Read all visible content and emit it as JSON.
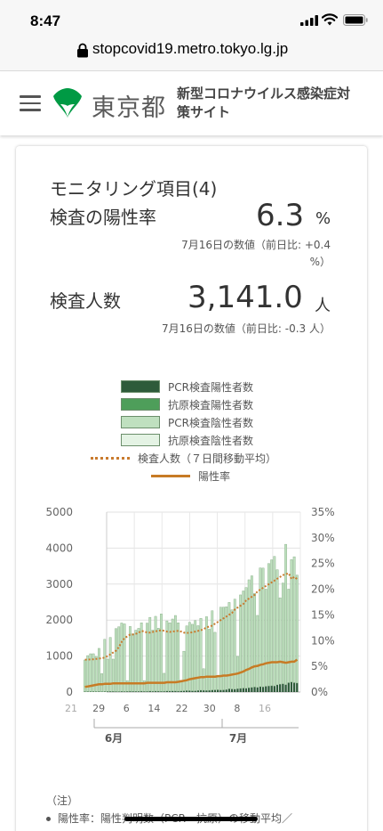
{
  "statusbar": {
    "time": "8:47"
  },
  "browser": {
    "url": "stopcovid19.metro.tokyo.lg.jp"
  },
  "header": {
    "logo_text": "東京都",
    "site_title": "新型コロナウイルス感染症対策サイト"
  },
  "card": {
    "title": "モニタリング項目(4)",
    "positive_rate": {
      "label": "検査の陽性率",
      "value": "6.3",
      "unit": "%",
      "sub": "7月16日の数値（前日比: +0.4 %）"
    },
    "test_count": {
      "label": "検査人数",
      "value": "3,141.0",
      "unit": "人",
      "sub": "7月16日の数値（前日比: -0.3 人）"
    },
    "legend": [
      {
        "label": "PCR検査陽性者数",
        "color": "#2e5b3a"
      },
      {
        "label": "抗原検査陽性者数",
        "color": "#4e9e5a"
      },
      {
        "label": "PCR検査陰性者数",
        "color": "#bfe0bf"
      },
      {
        "label": "抗原検査陰性者数",
        "color": "#e4f3e4"
      },
      {
        "label": "検査人数（７日間移動平均）",
        "color": "#c97b2e",
        "style": "dotted"
      },
      {
        "label": "陽性率",
        "color": "#c77b25",
        "style": "solid"
      }
    ],
    "notes": {
      "heading": "（注）",
      "first": "陽性率：陽性判明数（PCR・抗原）の移動平均／"
    }
  },
  "chart_data": {
    "type": "bar",
    "title": "",
    "x_tick_labels": [
      "21",
      "29",
      "6",
      "14",
      "22",
      "30",
      "8",
      "16"
    ],
    "month_labels": [
      "6月",
      "7月"
    ],
    "y_left": {
      "ticks": [
        "0",
        "1000",
        "2000",
        "3000",
        "4000",
        "5000"
      ],
      "ylim": [
        0,
        5000
      ]
    },
    "y_right": {
      "ticks": [
        "0%",
        "5%",
        "10%",
        "15%",
        "20%",
        "25%",
        "30%",
        "35%"
      ],
      "ylim": [
        0,
        35
      ]
    },
    "start": "5月21日",
    "end": "7月16日",
    "series": [
      {
        "name": "PCR検査陽性者数",
        "values": [
          12,
          13,
          14,
          15,
          13,
          14,
          12,
          15,
          16,
          18,
          17,
          14,
          13,
          20,
          15,
          18,
          22,
          20,
          19,
          21,
          24,
          18,
          17,
          26,
          22,
          25,
          24,
          20,
          22,
          28,
          26,
          30,
          28,
          24,
          30,
          35,
          40,
          38,
          34,
          35,
          45,
          50,
          48,
          44,
          48,
          58,
          60,
          62,
          58,
          60,
          70,
          90,
          85,
          80,
          92,
          100,
          110,
          105,
          120,
          130,
          140,
          130,
          150,
          145,
          160,
          170,
          175,
          170,
          200,
          220,
          230,
          206,
          260,
          280,
          260,
          250
        ]
      },
      {
        "name": "抗原検査陽性者数",
        "values": [
          0,
          0,
          0,
          0,
          0,
          0,
          0,
          0,
          0,
          0,
          0,
          0,
          0,
          0,
          0,
          0,
          0,
          0,
          0,
          0,
          0,
          0,
          0,
          0,
          0,
          0,
          0,
          0,
          0,
          0,
          0,
          0,
          0,
          0,
          0,
          0,
          0,
          0,
          0,
          0,
          0,
          0,
          0,
          0,
          0,
          0,
          0,
          0,
          0,
          0,
          0,
          0,
          0,
          0,
          0,
          0,
          0,
          0,
          0,
          0,
          0,
          0,
          0,
          0,
          0,
          0,
          0,
          0,
          0,
          0,
          0,
          0,
          0,
          0,
          0,
          0
        ]
      },
      {
        "name": "PCR検査陰性者数",
        "values": [
          880,
          1000,
          1050,
          1050,
          980,
          1200,
          500,
          1450,
          900,
          1500,
          900,
          1750,
          1800,
          1900,
          1880,
          300,
          1800,
          1600,
          1700,
          1750,
          1900,
          300,
          1900,
          2050,
          1700,
          2080,
          1750,
          2150,
          500,
          1950,
          1900,
          2000,
          2100,
          1900,
          300,
          1100,
          1800,
          1900,
          1850,
          1950,
          1800,
          2000,
          600,
          2050,
          1700,
          2200,
          1600,
          400,
          2300,
          2300,
          2300,
          2400,
          2200,
          2500,
          900,
          2600,
          2700,
          2800,
          3000,
          3100,
          2600,
          2000,
          3300,
          3300,
          2700,
          3400,
          3500,
          3600,
          3200,
          2400,
          2800,
          3900,
          2600,
          3400,
          3500,
          3000
        ]
      },
      {
        "name": "抗原検査陰性者数",
        "values": [
          0,
          0,
          0,
          0,
          0,
          0,
          0,
          0,
          0,
          0,
          0,
          0,
          0,
          0,
          0,
          0,
          0,
          0,
          0,
          0,
          0,
          0,
          0,
          0,
          0,
          0,
          0,
          0,
          0,
          0,
          0,
          0,
          0,
          0,
          0,
          0,
          0,
          0,
          0,
          0,
          0,
          0,
          0,
          0,
          0,
          0,
          0,
          0,
          0,
          0,
          0,
          0,
          0,
          0,
          0,
          0,
          0,
          0,
          0,
          0,
          0,
          0,
          0,
          0,
          0,
          0,
          0,
          0,
          0,
          0,
          0,
          0,
          0,
          0,
          0,
          0
        ]
      },
      {
        "name": "検査人数（７日間移動平均）",
        "axis": "left",
        "values": [
          900,
          900,
          905,
          910,
          920,
          930,
          940,
          960,
          1000,
          1050,
          1100,
          1150,
          1250,
          1400,
          1500,
          1550,
          1600,
          1600,
          1620,
          1650,
          1700,
          1680,
          1650,
          1650,
          1670,
          1690,
          1700,
          1720,
          1700,
          1680,
          1670,
          1680,
          1690,
          1700,
          1680,
          1650,
          1640,
          1650,
          1660,
          1680,
          1700,
          1720,
          1750,
          1800,
          1820,
          1850,
          1900,
          1950,
          2000,
          2050,
          2100,
          2150,
          2200,
          2300,
          2350,
          2400,
          2450,
          2550,
          2600,
          2650,
          2700,
          2800,
          2850,
          2900,
          2950,
          3000,
          3050,
          3100,
          3150,
          3200,
          3250,
          3280,
          3300,
          3141,
          3200,
          3141
        ]
      },
      {
        "name": "陽性率",
        "axis": "right",
        "values": [
          1.0,
          1.1,
          1.2,
          1.3,
          1.4,
          1.5,
          1.5,
          1.6,
          1.6,
          1.6,
          1.7,
          1.7,
          1.7,
          1.7,
          1.7,
          1.7,
          1.7,
          1.7,
          1.7,
          1.7,
          1.7,
          1.7,
          1.8,
          1.8,
          1.8,
          1.8,
          1.8,
          1.8,
          1.8,
          1.9,
          1.9,
          1.9,
          1.9,
          2.0,
          2.1,
          2.2,
          2.3,
          2.5,
          2.6,
          2.7,
          2.8,
          2.9,
          2.9,
          3.0,
          3.0,
          3.0,
          3.0,
          3.1,
          3.1,
          3.2,
          3.2,
          3.3,
          3.4,
          3.5,
          3.6,
          3.8,
          4.0,
          4.3,
          4.5,
          4.8,
          5.0,
          5.1,
          5.3,
          5.4,
          5.6,
          5.7,
          5.8,
          5.8,
          5.8,
          5.9,
          5.8,
          5.7,
          5.8,
          5.9,
          5.9,
          6.3
        ]
      }
    ],
    "grid": true,
    "legend_position": "top-center"
  }
}
